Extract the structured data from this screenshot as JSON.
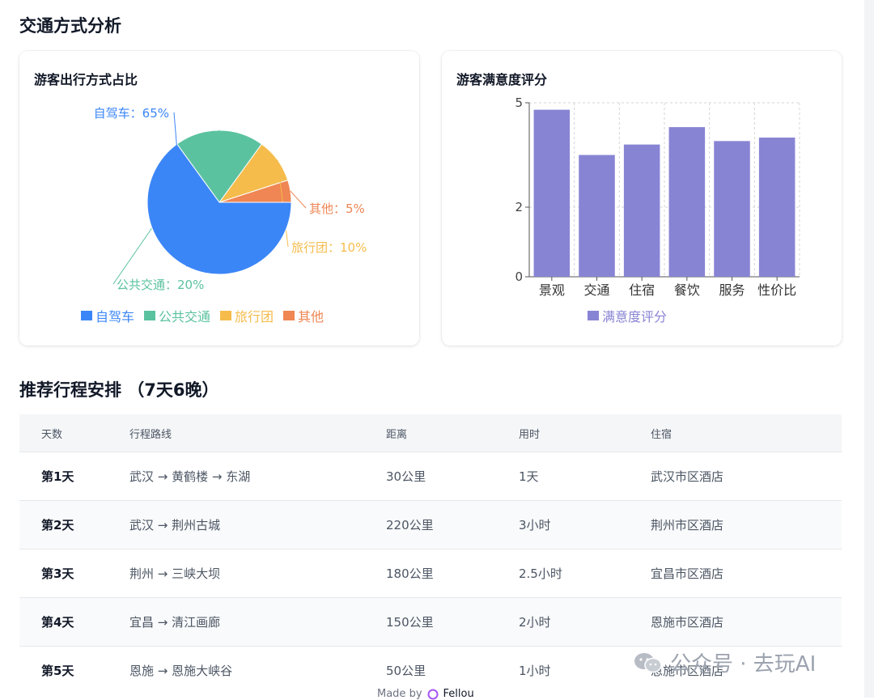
{
  "transport_section": {
    "title": "交通方式分析"
  },
  "pie_card": {
    "title": "游客出行方式占比"
  },
  "bar_card": {
    "title": "游客满意度评分"
  },
  "chart_data": [
    {
      "type": "pie",
      "title": "游客出行方式占比",
      "slices": [
        {
          "name": "自驾车",
          "value": 65,
          "label": "自驾车：65%",
          "color": "#3b86f7"
        },
        {
          "name": "公共交通",
          "value": 20,
          "label": "公共交通：20%",
          "color": "#5bc2a0"
        },
        {
          "name": "旅行团",
          "value": 10,
          "label": "旅行团：10%",
          "color": "#f5bc4c"
        },
        {
          "name": "其他",
          "value": 5,
          "label": "其他：5%",
          "color": "#ef8653"
        }
      ],
      "legend_position": "bottom"
    },
    {
      "type": "bar",
      "title": "游客满意度评分",
      "categories": [
        "景观",
        "交通",
        "住宿",
        "餐饮",
        "服务",
        "性价比"
      ],
      "series": [
        {
          "name": "满意度评分",
          "values": [
            4.8,
            3.5,
            3.8,
            4.3,
            3.9,
            4.0
          ],
          "color": "#8884d4"
        }
      ],
      "yticks": [
        "0",
        "2",
        "5"
      ],
      "ylim": [
        0,
        5
      ],
      "grid": true,
      "legend_position": "bottom"
    }
  ],
  "itinerary_section": {
    "title": "推荐行程安排 （7天6晚）"
  },
  "itinerary_table": {
    "headers": [
      "天数",
      "行程路线",
      "距离",
      "用时",
      "住宿"
    ],
    "rows": [
      [
        "第1天",
        "武汉 → 黄鹤楼 → 东湖",
        "30公里",
        "1天",
        "武汉市区酒店"
      ],
      [
        "第2天",
        "武汉 → 荆州古城",
        "220公里",
        "3小时",
        "荆州市区酒店"
      ],
      [
        "第3天",
        "荆州 → 三峡大坝",
        "180公里",
        "2.5小时",
        "宜昌市区酒店"
      ],
      [
        "第4天",
        "宜昌 → 清江画廊",
        "150公里",
        "2小时",
        "恩施市区酒店"
      ],
      [
        "第5天",
        "恩施 → 恩施大峡谷",
        "50公里",
        "1小时",
        "恩施市区酒店"
      ]
    ]
  },
  "watermark": {
    "text": "公众号 · 去玩AI"
  },
  "footer": {
    "made_by": "Made by",
    "brand": "Fellou"
  }
}
